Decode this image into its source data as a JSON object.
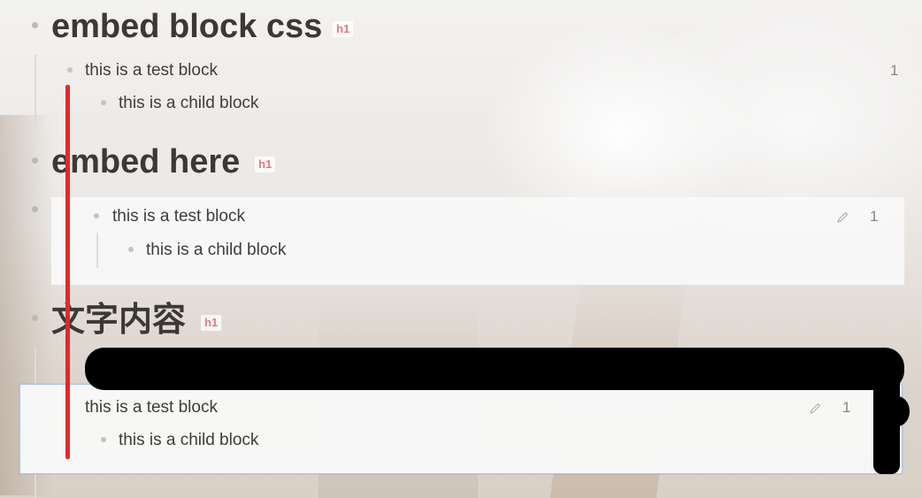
{
  "sections": [
    {
      "heading": "embed block css",
      "badge": "h1",
      "block": {
        "text": "this is a test block",
        "count": "1",
        "child": "this is a child block"
      }
    },
    {
      "heading": "embed here",
      "badge": "h1",
      "embed": {
        "text": "this is a test block",
        "count": "1",
        "child": "this is a child block"
      }
    },
    {
      "heading": "文字内容",
      "badge": "h1",
      "embed": {
        "text": "this is a test block",
        "count": "1",
        "child": "this is a child block"
      }
    }
  ],
  "icons": {
    "edit": "pencil-icon"
  },
  "colors": {
    "annotation_line": "#e12a2a",
    "redaction": "#000000",
    "badge": "#e07b7b",
    "selection_border": "#a9c3e8"
  }
}
